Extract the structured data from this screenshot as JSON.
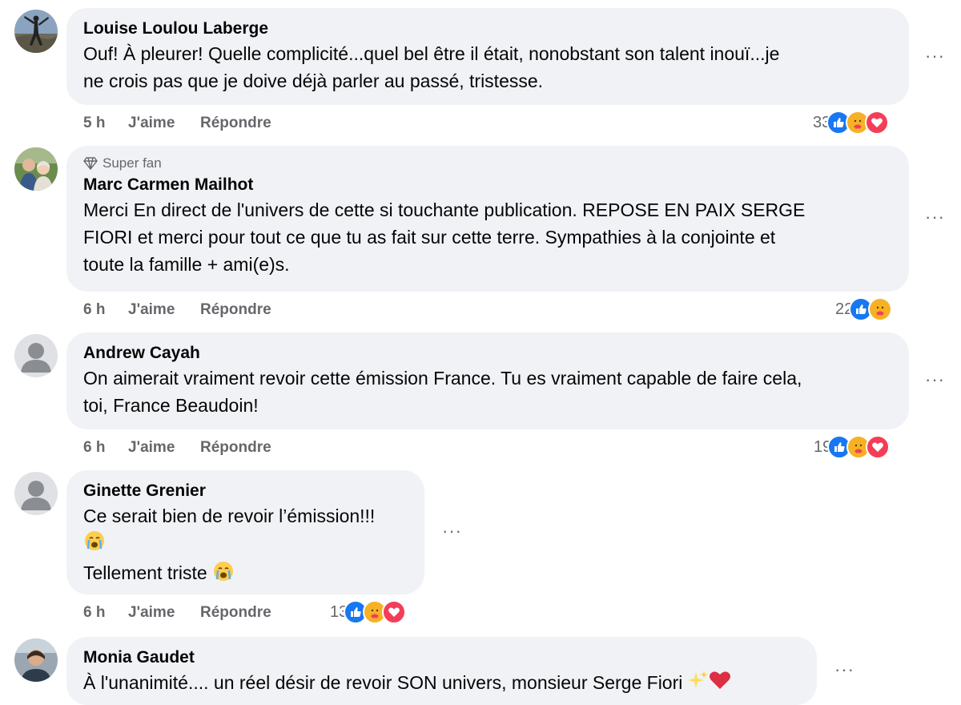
{
  "comments": [
    {
      "author": "Louise Loulou Laberge",
      "lines": [
        "Ouf! À pleurer! Quelle complicité...quel bel être il était, nonobstant son talent inouï...je",
        "ne crois pas que je doive déjà parler au passé, tristesse."
      ],
      "time": "5 h",
      "like_label": "J'aime",
      "reply_label": "Répondre",
      "reaction_count": "33",
      "reactions": [
        "like",
        "care",
        "love"
      ]
    },
    {
      "badge": "Super fan",
      "author": "Marc Carmen Mailhot",
      "lines": [
        "Merci En direct de l'univers de cette si touchante publication. REPOSE EN PAIX SERGE",
        "FIORI et merci pour tout ce que tu as fait sur cette terre. Sympathies à la conjointe et",
        "toute la famille + ami(e)s."
      ],
      "time": "6 h",
      "like_label": "J'aime",
      "reply_label": "Répondre",
      "reaction_count": "22",
      "reactions": [
        "like",
        "care"
      ]
    },
    {
      "author": "Andrew Cayah",
      "lines": [
        "On aimerait vraiment revoir cette émission France. Tu es vraiment capable de faire cela,",
        "toi, France Beaudoin!"
      ],
      "time": "6 h",
      "like_label": "J'aime",
      "reply_label": "Répondre",
      "reaction_count": "19",
      "reactions": [
        "like",
        "care",
        "love"
      ]
    },
    {
      "author": "Ginette Grenier",
      "lines": [
        "Ce serait bien de revoir l’émission!!!",
        "",
        "Tellement triste"
      ],
      "time": "6 h",
      "like_label": "J'aime",
      "reply_label": "Répondre",
      "reaction_count": "13",
      "reactions": [
        "like",
        "care",
        "love"
      ]
    },
    {
      "author": "Monia Gaudet",
      "lines": [
        "À l'unanimité.... un réel désir de revoir SON univers, monsieur Serge Fiori"
      ]
    }
  ],
  "more_label": "···",
  "colors": {
    "bubble": "#f0f2f5",
    "meta": "#65676b",
    "like": "#1877f2",
    "love": "#f33e58",
    "care": "#f7b125"
  }
}
